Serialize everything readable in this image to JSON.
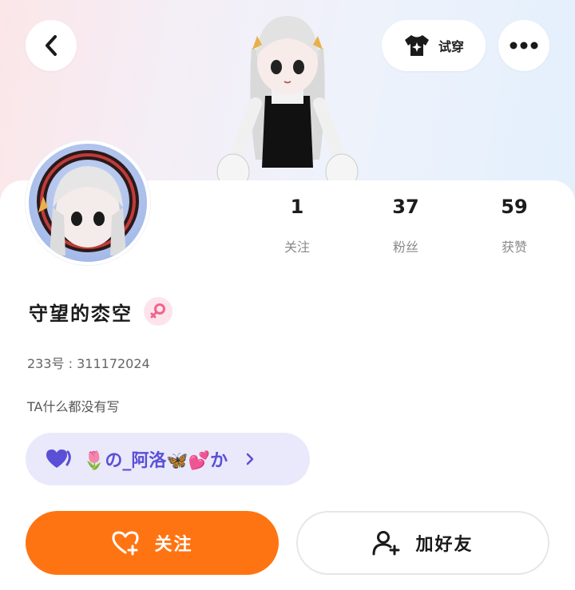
{
  "header": {
    "back_icon": "chevron-left-icon",
    "try_on_label": "试穿",
    "try_on_icon": "tshirt-star-icon",
    "more_icon": "more-dots-icon"
  },
  "profile": {
    "name": "守望的枩空",
    "gender_icon": "female-icon",
    "uid_text": "233号 : 311172024",
    "bio": "TA什么都没有写"
  },
  "stats": [
    {
      "value": "1",
      "label": "关注"
    },
    {
      "value": "37",
      "label": "粉丝"
    },
    {
      "value": "59",
      "label": "获赞"
    }
  ],
  "tag": {
    "text": "🌷の_阿洛🦋💕か",
    "icon": "heart-badge-icon"
  },
  "actions": {
    "follow_label": "关注",
    "follow_icon": "heart-plus-icon",
    "add_friend_label": "加好友",
    "add_friend_icon": "person-add-icon"
  },
  "colors": {
    "accent": "#ff7412",
    "tag_bg": "#e9e9fb",
    "tag_text": "#5b4fd6",
    "gender_bg": "#fde4ec"
  }
}
